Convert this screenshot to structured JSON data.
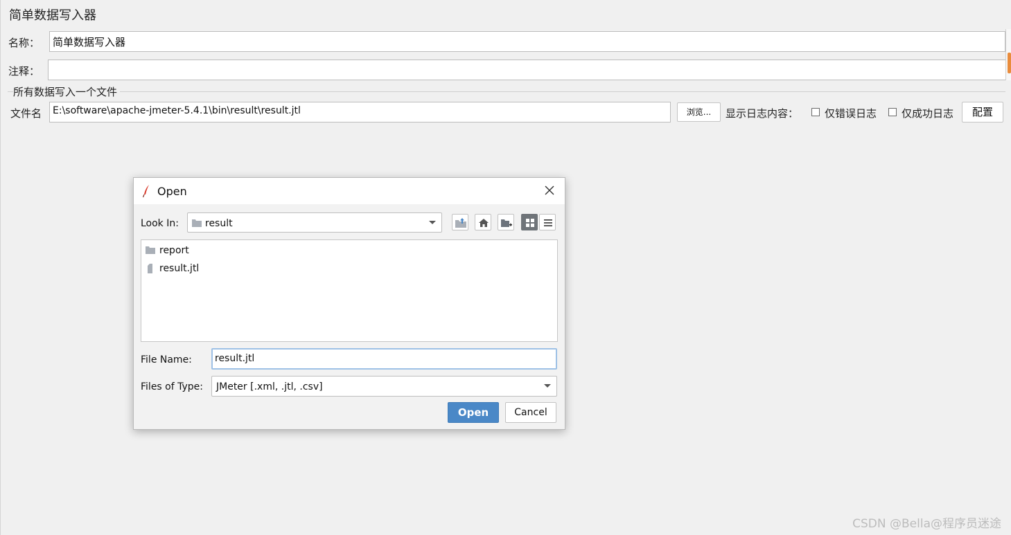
{
  "panel": {
    "title": "简单数据写入器",
    "name_label": "名称：",
    "name_value": "简单数据写入器",
    "comment_label": "注释：",
    "comment_value": "",
    "group_title": "所有数据写入一个文件",
    "file_label": "文件名",
    "file_value": "E:\\software\\apache-jmeter-5.4.1\\bin\\result\\result.jtl",
    "browse_label": "浏览...",
    "log_label": "显示日志内容：",
    "errors_only_label": "仅错误日志",
    "errors_only_checked": false,
    "success_only_label": "仅成功日志",
    "success_only_checked": false,
    "configure_label": "配置"
  },
  "dialog": {
    "title": "Open",
    "title_icon": "feather-icon",
    "look_in_label": "Look In:",
    "look_in_value": "result",
    "toolbar": [
      {
        "name": "up-folder-icon"
      },
      {
        "name": "home-icon"
      },
      {
        "name": "new-folder-icon"
      },
      {
        "name": "list-view-icon",
        "selected": true
      },
      {
        "name": "details-view-icon",
        "selected": false
      }
    ],
    "files": [
      {
        "name": "report",
        "type": "folder"
      },
      {
        "name": "result.jtl",
        "type": "file"
      }
    ],
    "file_name_label": "File Name:",
    "file_name_value": "result.jtl",
    "file_type_label": "Files of Type:",
    "file_type_value": "JMeter [.xml, .jtl, .csv]",
    "open_label": "Open",
    "cancel_label": "Cancel"
  },
  "watermark": "CSDN @Bella@程序员迷途",
  "colors": {
    "accent": "#4a88c7",
    "scroll_thumb": "#e98c3c"
  }
}
